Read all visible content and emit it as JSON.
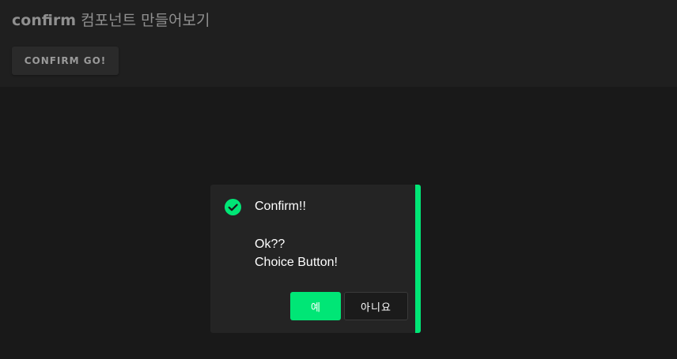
{
  "header": {
    "title_bold": "confirm",
    "title_rest": " 컴포넌트 만들어보기",
    "confirm_button_label": "CONFIRM GO!"
  },
  "dialog": {
    "title": "Confirm!!",
    "message_lines": [
      "Ok??",
      "Choice Button!"
    ],
    "icon": "check-circle-icon",
    "yes_label": "예",
    "no_label": "아니요"
  },
  "colors": {
    "accent": "#00e676",
    "background": "#191919",
    "panel": "#1f1f1f",
    "dialog": "#242424"
  }
}
